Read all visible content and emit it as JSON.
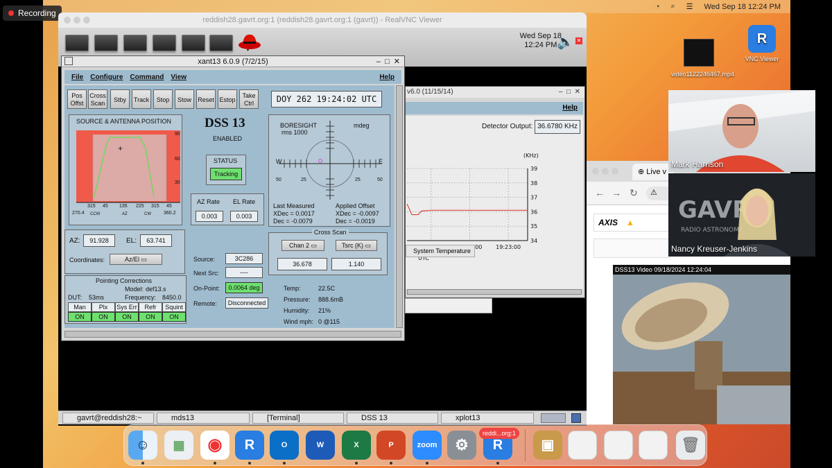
{
  "recording": {
    "label": "Recording"
  },
  "mac_menubar": {
    "datetime": "Wed Sep 18  12:24 PM"
  },
  "vnc": {
    "title": "reddish28.gavrt.org:1 (reddish28.gavrt.org:1 (gavrt)) - RealVNC Viewer",
    "clock_day": "Wed Sep 18",
    "clock_time": "12:24 PM"
  },
  "xant": {
    "title": "xant13 6.0.9 (7/2/15)",
    "menu": [
      "File",
      "Configure",
      "Command",
      "View"
    ],
    "help": "Help",
    "buttons": [
      "Pos Offst",
      "Cross Scan",
      "Stby",
      "Track",
      "Stop",
      "Stow",
      "Reset",
      "Estop",
      "Take Ctrl"
    ],
    "doy": "DOY 262 19:24:02 UTC",
    "source_panel_title": "SOURCE & ANTENNA POSITION",
    "az_axis_labels": [
      "315",
      "45",
      "135",
      "225",
      "315",
      "45"
    ],
    "az_axis_extra": [
      "270.4",
      "CCW",
      "AZ",
      "CW",
      "360.2"
    ],
    "el_axis_labels": [
      "90",
      "60",
      "30"
    ],
    "dss_title": "DSS 13",
    "dss_state": "ENABLED",
    "status_label": "STATUS",
    "status_value": "Tracking",
    "az_rate_label": "AZ Rate",
    "el_rate_label": "EL Rate",
    "az_rate": "0.003",
    "el_rate": "0.003",
    "boresight_title": "BORESIGHT",
    "boresight_unit": "mdeg",
    "boresight_rms": "rms 1000",
    "boresight_w": "W",
    "boresight_e": "E",
    "boresight_ticks": [
      "50",
      "25",
      "25",
      "50"
    ],
    "last_measured_label": "Last Measured",
    "applied_offset_label": "Applied Offset",
    "xdec_meas": "XDec = 0.0017",
    "dec_meas": "Dec = -0.0079",
    "xdec_app": "XDec = -0.0097",
    "dec_app": "Dec = -0.0019",
    "az_label": "AZ:",
    "az_value": "91.928",
    "el_label": "EL:",
    "el_value": "63.741",
    "coordinates_label": "Coordinates:",
    "coordinates_value": "Az/El",
    "pointing_title": "Pointing Corrections",
    "model_label": "Model:",
    "model_value": "def13.s",
    "dut_label": "DUT:",
    "dut_value": "53ms",
    "freq_label": "Frequency:",
    "freq_value": "8450.0",
    "corr_headers": [
      "Man",
      "Plx",
      "Sys Err",
      "Refr",
      "Squint"
    ],
    "corr_values": [
      "ON",
      "ON",
      "ON",
      "ON",
      "ON"
    ],
    "source_label": "Source:",
    "source_value": "3C286",
    "next_src_label": "Next Src:",
    "next_src_value": "----",
    "onpoint_label": "On-Point:",
    "onpoint_value": "0.0064 deg",
    "remote_label": "Remote:",
    "remote_value": "Disconnected",
    "cross_scan_title": "Cross Scan",
    "chan_select": "Chan  2",
    "tsrc_select": "Tsrc (K)",
    "cs_val1": "36.678",
    "cs_val2": "1.140",
    "temp_label": "Temp:",
    "temp_value": "22.5C",
    "pressure_label": "Pressure:",
    "pressure_value": "888.6mB",
    "humidity_label": "Humidity:",
    "humidity_value": "21%",
    "wind_label": "Wind mph:",
    "wind_value": "0  @115"
  },
  "xplot": {
    "title": "v6.0 (11/15/14)",
    "help": "Help",
    "detector_label": "Detector Output:",
    "detector_value": "36.6780 KHz",
    "unit": "(KHz)",
    "x_axis_label": "UTC",
    "status_tab": "System Temperature"
  },
  "chart_data": {
    "type": "line",
    "title": "",
    "xlabel": "UTC",
    "ylabel": "(KHz)",
    "x": [
      "19:17:00",
      "19:17:40",
      "19:18:00",
      "19:18:20",
      "19:18:30",
      "19:19:00",
      "19:20:00",
      "19:21:00",
      "19:22:00",
      "19:23:00",
      "19:24:00"
    ],
    "series": [
      {
        "values": [
          36.55,
          36.55,
          35.8,
          35.8,
          36.05,
          36.1,
          36.1,
          36.1,
          36.1,
          36.1,
          36.1
        ]
      }
    ],
    "x_ticks": [
      "19:19:00",
      "19:21:00",
      "19:23:00"
    ],
    "y_ticks": [
      "39",
      "38",
      "37",
      "36",
      "35",
      "34"
    ],
    "ylim": [
      34,
      39
    ],
    "line_color": "#e0443a",
    "grid": true
  },
  "browser": {
    "tab_label": "Live v",
    "axis_logo": "AXIS",
    "video_title": "DSS13 Video 09/18/2024 12:24:04"
  },
  "participants": {
    "mark": "Mark Harrison",
    "nancy": "Nancy Kreuser-Jenkins",
    "nancy_bg_text": "GAVRT",
    "nancy_bg_sub": "RADIO ASTRONOMY"
  },
  "desktop_icons": {
    "video_file": "video1122246467.mp4",
    "vnc_viewer": "VNC Viewer"
  },
  "taskbar": [
    "gavrt@reddish28:~",
    "mds13",
    "[Terminal]",
    "DSS 13",
    "xplot13"
  ],
  "dock": {
    "apps": [
      "Finder",
      "Launchpad",
      "Chrome",
      "VNC Viewer",
      "Outlook",
      "Word",
      "Excel",
      "PowerPoint",
      "zoom",
      "System Settings",
      "VNC Viewer"
    ],
    "badge": "reddi...org:1"
  },
  "colors": {
    "accent_panel": "#9fbccf",
    "ok_green": "#6ee06e",
    "plot_red": "#e0443a"
  }
}
